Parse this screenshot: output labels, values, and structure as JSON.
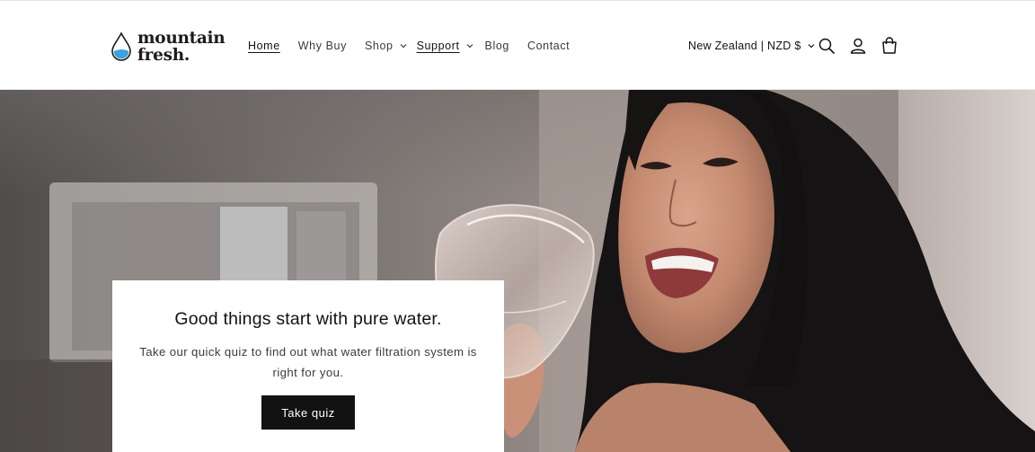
{
  "brand": {
    "line1": "mountain",
    "line2": "fresh.",
    "accent": "#3aa3dc"
  },
  "nav": {
    "items": [
      {
        "label": "Home",
        "active": true
      },
      {
        "label": "Why Buy"
      },
      {
        "label": "Shop",
        "dropdown": true
      },
      {
        "label": "Support",
        "dropdown": true,
        "underlined": true
      },
      {
        "label": "Blog"
      },
      {
        "label": "Contact"
      }
    ]
  },
  "header": {
    "locale_label": "New Zealand | NZD $",
    "icons": [
      "search-icon",
      "account-icon",
      "cart-icon"
    ]
  },
  "hero": {
    "title": "Good things start with pure water.",
    "body": "Take our quick quiz to find out what water filtration system is right for you.",
    "button_label": "Take quiz"
  }
}
